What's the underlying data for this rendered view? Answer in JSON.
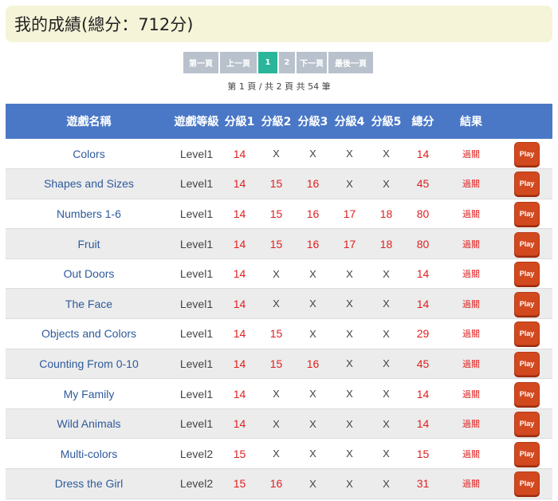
{
  "title": "我的成績(總分：712分)",
  "pagination": {
    "first": "第一頁",
    "prev": "上一頁",
    "pages": [
      "1",
      "2"
    ],
    "current": "1",
    "next": "下一頁",
    "last": "最後一頁",
    "info": "第 1 頁 / 共 2 頁 共 54 筆"
  },
  "table": {
    "headers": {
      "name": "遊戲名稱",
      "level": "遊戲等級",
      "s1": "分級1",
      "s2": "分級2",
      "s3": "分級3",
      "s4": "分級4",
      "s5": "分級5",
      "total": "總分",
      "result": "結果"
    },
    "rows": [
      {
        "name": "Colors",
        "level": "Level1",
        "s1": "14",
        "s2": "X",
        "s3": "X",
        "s4": "X",
        "s5": "X",
        "total": "14",
        "result": "過關",
        "play": "Play"
      },
      {
        "name": "Shapes and Sizes",
        "level": "Level1",
        "s1": "14",
        "s2": "15",
        "s3": "16",
        "s4": "X",
        "s5": "X",
        "total": "45",
        "result": "過關",
        "play": "Play"
      },
      {
        "name": "Numbers 1-6",
        "level": "Level1",
        "s1": "14",
        "s2": "15",
        "s3": "16",
        "s4": "17",
        "s5": "18",
        "total": "80",
        "result": "過關",
        "play": "Play"
      },
      {
        "name": "Fruit",
        "level": "Level1",
        "s1": "14",
        "s2": "15",
        "s3": "16",
        "s4": "17",
        "s5": "18",
        "total": "80",
        "result": "過關",
        "play": "Play"
      },
      {
        "name": "Out Doors",
        "level": "Level1",
        "s1": "14",
        "s2": "X",
        "s3": "X",
        "s4": "X",
        "s5": "X",
        "total": "14",
        "result": "過關",
        "play": "Play"
      },
      {
        "name": "The Face",
        "level": "Level1",
        "s1": "14",
        "s2": "X",
        "s3": "X",
        "s4": "X",
        "s5": "X",
        "total": "14",
        "result": "過關",
        "play": "Play"
      },
      {
        "name": "Objects and Colors",
        "level": "Level1",
        "s1": "14",
        "s2": "15",
        "s3": "X",
        "s4": "X",
        "s5": "X",
        "total": "29",
        "result": "過關",
        "play": "Play"
      },
      {
        "name": "Counting From 0-10",
        "level": "Level1",
        "s1": "14",
        "s2": "15",
        "s3": "16",
        "s4": "X",
        "s5": "X",
        "total": "45",
        "result": "過關",
        "play": "Play"
      },
      {
        "name": "My Family",
        "level": "Level1",
        "s1": "14",
        "s2": "X",
        "s3": "X",
        "s4": "X",
        "s5": "X",
        "total": "14",
        "result": "過關",
        "play": "Play"
      },
      {
        "name": "Wild Animals",
        "level": "Level1",
        "s1": "14",
        "s2": "X",
        "s3": "X",
        "s4": "X",
        "s5": "X",
        "total": "14",
        "result": "過關",
        "play": "Play"
      },
      {
        "name": "Multi-colors",
        "level": "Level2",
        "s1": "15",
        "s2": "X",
        "s3": "X",
        "s4": "X",
        "s5": "X",
        "total": "15",
        "result": "過關",
        "play": "Play"
      },
      {
        "name": "Dress the Girl",
        "level": "Level2",
        "s1": "15",
        "s2": "16",
        "s3": "X",
        "s4": "X",
        "s5": "X",
        "total": "31",
        "result": "過關",
        "play": "Play"
      }
    ]
  },
  "colors": {
    "header_bg": "#4a78c7",
    "pager_bg": "#b8c1cc",
    "pager_active": "#2bb59a",
    "title_bg": "#f6f4d8",
    "score_red": "#e02020",
    "play_btn": "#d2491f"
  }
}
